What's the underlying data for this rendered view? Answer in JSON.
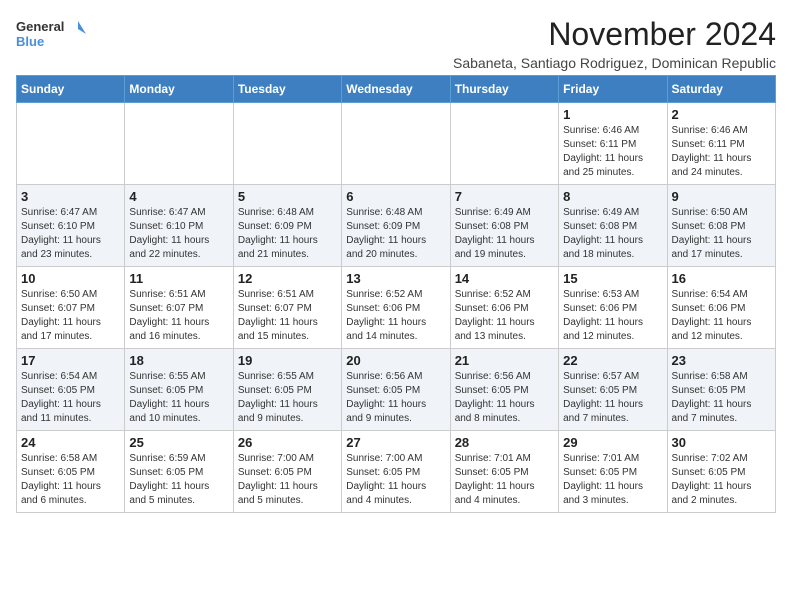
{
  "header": {
    "logo_line1": "General",
    "logo_line2": "Blue",
    "month": "November 2024",
    "location": "Sabaneta, Santiago Rodriguez, Dominican Republic"
  },
  "weekdays": [
    "Sunday",
    "Monday",
    "Tuesday",
    "Wednesday",
    "Thursday",
    "Friday",
    "Saturday"
  ],
  "weeks": [
    [
      {
        "day": "",
        "info": ""
      },
      {
        "day": "",
        "info": ""
      },
      {
        "day": "",
        "info": ""
      },
      {
        "day": "",
        "info": ""
      },
      {
        "day": "",
        "info": ""
      },
      {
        "day": "1",
        "info": "Sunrise: 6:46 AM\nSunset: 6:11 PM\nDaylight: 11 hours\nand 25 minutes."
      },
      {
        "day": "2",
        "info": "Sunrise: 6:46 AM\nSunset: 6:11 PM\nDaylight: 11 hours\nand 24 minutes."
      }
    ],
    [
      {
        "day": "3",
        "info": "Sunrise: 6:47 AM\nSunset: 6:10 PM\nDaylight: 11 hours\nand 23 minutes."
      },
      {
        "day": "4",
        "info": "Sunrise: 6:47 AM\nSunset: 6:10 PM\nDaylight: 11 hours\nand 22 minutes."
      },
      {
        "day": "5",
        "info": "Sunrise: 6:48 AM\nSunset: 6:09 PM\nDaylight: 11 hours\nand 21 minutes."
      },
      {
        "day": "6",
        "info": "Sunrise: 6:48 AM\nSunset: 6:09 PM\nDaylight: 11 hours\nand 20 minutes."
      },
      {
        "day": "7",
        "info": "Sunrise: 6:49 AM\nSunset: 6:08 PM\nDaylight: 11 hours\nand 19 minutes."
      },
      {
        "day": "8",
        "info": "Sunrise: 6:49 AM\nSunset: 6:08 PM\nDaylight: 11 hours\nand 18 minutes."
      },
      {
        "day": "9",
        "info": "Sunrise: 6:50 AM\nSunset: 6:08 PM\nDaylight: 11 hours\nand 17 minutes."
      }
    ],
    [
      {
        "day": "10",
        "info": "Sunrise: 6:50 AM\nSunset: 6:07 PM\nDaylight: 11 hours\nand 17 minutes."
      },
      {
        "day": "11",
        "info": "Sunrise: 6:51 AM\nSunset: 6:07 PM\nDaylight: 11 hours\nand 16 minutes."
      },
      {
        "day": "12",
        "info": "Sunrise: 6:51 AM\nSunset: 6:07 PM\nDaylight: 11 hours\nand 15 minutes."
      },
      {
        "day": "13",
        "info": "Sunrise: 6:52 AM\nSunset: 6:06 PM\nDaylight: 11 hours\nand 14 minutes."
      },
      {
        "day": "14",
        "info": "Sunrise: 6:52 AM\nSunset: 6:06 PM\nDaylight: 11 hours\nand 13 minutes."
      },
      {
        "day": "15",
        "info": "Sunrise: 6:53 AM\nSunset: 6:06 PM\nDaylight: 11 hours\nand 12 minutes."
      },
      {
        "day": "16",
        "info": "Sunrise: 6:54 AM\nSunset: 6:06 PM\nDaylight: 11 hours\nand 12 minutes."
      }
    ],
    [
      {
        "day": "17",
        "info": "Sunrise: 6:54 AM\nSunset: 6:05 PM\nDaylight: 11 hours\nand 11 minutes."
      },
      {
        "day": "18",
        "info": "Sunrise: 6:55 AM\nSunset: 6:05 PM\nDaylight: 11 hours\nand 10 minutes."
      },
      {
        "day": "19",
        "info": "Sunrise: 6:55 AM\nSunset: 6:05 PM\nDaylight: 11 hours\nand 9 minutes."
      },
      {
        "day": "20",
        "info": "Sunrise: 6:56 AM\nSunset: 6:05 PM\nDaylight: 11 hours\nand 9 minutes."
      },
      {
        "day": "21",
        "info": "Sunrise: 6:56 AM\nSunset: 6:05 PM\nDaylight: 11 hours\nand 8 minutes."
      },
      {
        "day": "22",
        "info": "Sunrise: 6:57 AM\nSunset: 6:05 PM\nDaylight: 11 hours\nand 7 minutes."
      },
      {
        "day": "23",
        "info": "Sunrise: 6:58 AM\nSunset: 6:05 PM\nDaylight: 11 hours\nand 7 minutes."
      }
    ],
    [
      {
        "day": "24",
        "info": "Sunrise: 6:58 AM\nSunset: 6:05 PM\nDaylight: 11 hours\nand 6 minutes."
      },
      {
        "day": "25",
        "info": "Sunrise: 6:59 AM\nSunset: 6:05 PM\nDaylight: 11 hours\nand 5 minutes."
      },
      {
        "day": "26",
        "info": "Sunrise: 7:00 AM\nSunset: 6:05 PM\nDaylight: 11 hours\nand 5 minutes."
      },
      {
        "day": "27",
        "info": "Sunrise: 7:00 AM\nSunset: 6:05 PM\nDaylight: 11 hours\nand 4 minutes."
      },
      {
        "day": "28",
        "info": "Sunrise: 7:01 AM\nSunset: 6:05 PM\nDaylight: 11 hours\nand 4 minutes."
      },
      {
        "day": "29",
        "info": "Sunrise: 7:01 AM\nSunset: 6:05 PM\nDaylight: 11 hours\nand 3 minutes."
      },
      {
        "day": "30",
        "info": "Sunrise: 7:02 AM\nSunset: 6:05 PM\nDaylight: 11 hours\nand 2 minutes."
      }
    ]
  ]
}
